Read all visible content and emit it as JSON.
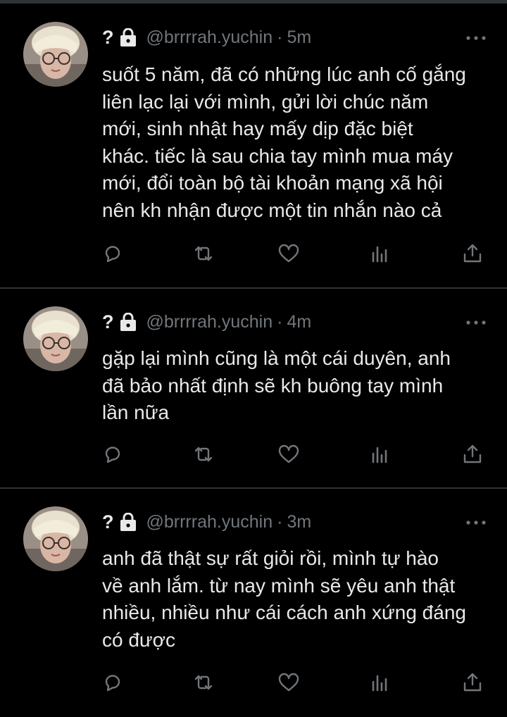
{
  "tweets": [
    {
      "name": "?",
      "handle": "@brrrrah.yuchin",
      "separator": "·",
      "time": "5m",
      "lines": [
        "suốt 5 năm, đã có những lúc anh cố gắng",
        "liên lạc lại với mình, gửi lời chúc năm",
        "mới, sinh nhật hay mấy dịp đặc biệt",
        "khác. tiếc là sau chia tay mình mua máy",
        "mới, đổi toàn bộ tài khoản mạng xã hội",
        "nên kh nhận được một tin nhắn nào cả"
      ]
    },
    {
      "name": "?",
      "handle": "@brrrrah.yuchin",
      "separator": "·",
      "time": "4m",
      "lines": [
        "gặp lại mình cũng là một cái duyên, anh",
        "đã bảo nhất định sẽ kh buông tay mình",
        "lần nữa"
      ]
    },
    {
      "name": "?",
      "handle": "@brrrrah.yuchin",
      "separator": "·",
      "time": "3m",
      "lines": [
        "anh đã thật sự rất giỏi rồi, mình tự hào",
        "về anh lắm. từ nay mình sẽ yêu anh thật",
        "nhiều, nhiều như cái cách anh xứng đáng",
        "có được"
      ]
    }
  ],
  "icons": {
    "header": [
      "lock-icon",
      "more-icon"
    ],
    "actions": [
      "reply-icon",
      "retweet-icon",
      "like-icon",
      "analytics-icon",
      "share-icon"
    ]
  },
  "colors": {
    "background": "#000000",
    "text": "#e7e9ea",
    "secondary": "#71767b",
    "divider": "#2f3336"
  }
}
